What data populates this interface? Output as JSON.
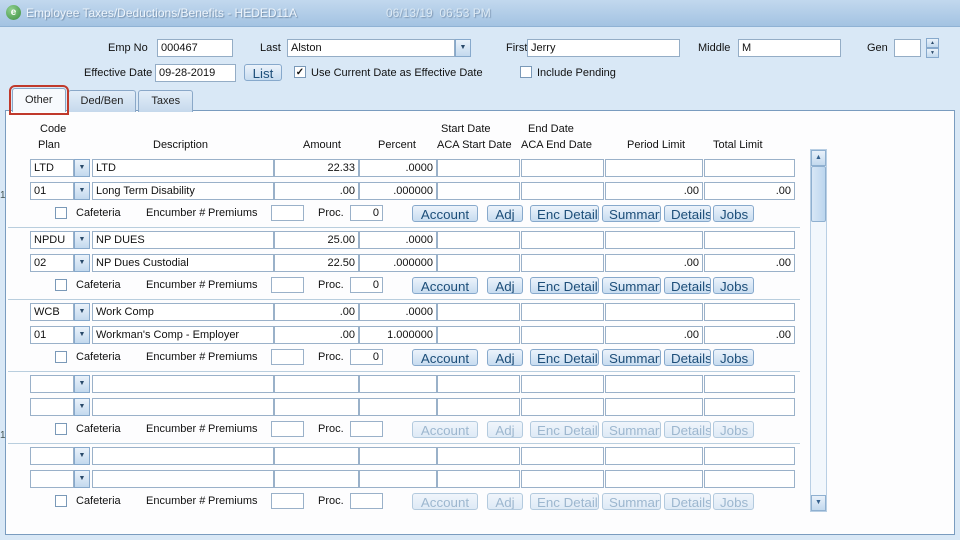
{
  "window": {
    "title": "Employee Taxes/Deductions/Benefits - HEDED11A",
    "timestamp": "06/13/19  06:53 PM"
  },
  "annotation": {
    "highlight_color": "#c0392b",
    "target": "Other tab"
  },
  "icons": {
    "dropdown": "▼",
    "up": "▲",
    "down": "▼",
    "check": "✓",
    "app_logo": "e"
  },
  "header": {
    "emp_no_label": "Emp No",
    "emp_no_value": "000467",
    "last_label": "Last",
    "last_value": "Alston",
    "first_label": "First",
    "first_value": "Jerry",
    "middle_label": "Middle",
    "middle_value": "M",
    "gen_label": "Gen",
    "gen_value": "",
    "effective_date_label": "Effective Date",
    "effective_date_value": "09-28-2019",
    "list_button": "List",
    "use_current_date_label": "Use Current Date as Effective Date",
    "use_current_date_checked": true,
    "include_pending_label": "Include Pending",
    "include_pending_checked": false
  },
  "tabs": [
    {
      "label": "Other",
      "selected": true,
      "highlighted": true
    },
    {
      "label": "Ded/Ben",
      "selected": false,
      "highlighted": false
    },
    {
      "label": "Taxes",
      "selected": false,
      "highlighted": false
    }
  ],
  "grid": {
    "headers": {
      "code": "Code",
      "plan": "Plan",
      "description": "Description",
      "amount": "Amount",
      "percent": "Percent",
      "start_date": "Start Date",
      "aca_start_date": "ACA Start Date",
      "end_date": "End Date",
      "aca_end_date": "ACA End Date",
      "period_limit": "Period Limit",
      "total_limit": "Total Limit"
    },
    "control_labels": {
      "cafeteria": "Cafeteria",
      "encumber": "Encumber #",
      "premiums": "Premiums",
      "proc": "Proc.",
      "buttons": [
        "Account",
        "Adj",
        "Enc Details",
        "Summary",
        "Details",
        "Jobs"
      ]
    },
    "groups": [
      {
        "code": "LTD",
        "code_desc": "LTD",
        "code_amount": "22.33",
        "code_percent": ".0000",
        "code_aca_start": "",
        "code_aca_end": "",
        "code_period_limit": "",
        "code_total_limit": "",
        "plan": "01",
        "plan_desc": "Long Term Disability",
        "plan_amount": ".00",
        "plan_percent": ".000000",
        "plan_aca_start": "",
        "plan_aca_end": "",
        "plan_period_limit": ".00",
        "plan_total_limit": ".00",
        "cafeteria_checked": false,
        "premiums_value": "",
        "proc_value": "0",
        "enabled": true
      },
      {
        "code": "NPDU",
        "code_desc": "NP DUES",
        "code_amount": "25.00",
        "code_percent": ".0000",
        "code_aca_start": "",
        "code_aca_end": "",
        "code_period_limit": "",
        "code_total_limit": "",
        "plan": "02",
        "plan_desc": "NP Dues Custodial",
        "plan_amount": "22.50",
        "plan_percent": ".000000",
        "plan_aca_start": "",
        "plan_aca_end": "",
        "plan_period_limit": ".00",
        "plan_total_limit": ".00",
        "cafeteria_checked": false,
        "premiums_value": "",
        "proc_value": "0",
        "enabled": true
      },
      {
        "code": "WCB",
        "code_desc": "Work Comp",
        "code_amount": ".00",
        "code_percent": ".0000",
        "code_aca_start": "",
        "code_aca_end": "",
        "code_period_limit": "",
        "code_total_limit": "",
        "plan": "01",
        "plan_desc": "Workman's Comp - Employer",
        "plan_amount": ".00",
        "plan_percent": "1.000000",
        "plan_aca_start": "",
        "plan_aca_end": "",
        "plan_period_limit": ".00",
        "plan_total_limit": ".00",
        "cafeteria_checked": false,
        "premiums_value": "",
        "proc_value": "0",
        "enabled": true
      },
      {
        "code": "",
        "code_desc": "",
        "code_amount": "",
        "code_percent": "",
        "code_aca_start": "",
        "code_aca_end": "",
        "code_period_limit": "",
        "code_total_limit": "",
        "plan": "",
        "plan_desc": "",
        "plan_amount": "",
        "plan_percent": "",
        "plan_aca_start": "",
        "plan_aca_end": "",
        "plan_period_limit": "",
        "plan_total_limit": "",
        "cafeteria_checked": false,
        "premiums_value": "",
        "proc_value": "",
        "enabled": false
      },
      {
        "code": "",
        "code_desc": "",
        "code_amount": "",
        "code_percent": "",
        "code_aca_start": "",
        "code_aca_end": "",
        "code_period_limit": "",
        "code_total_limit": "",
        "plan": "",
        "plan_desc": "",
        "plan_amount": "",
        "plan_percent": "",
        "plan_aca_start": "",
        "plan_aca_end": "",
        "plan_period_limit": "",
        "plan_total_limit": "",
        "cafeteria_checked": false,
        "premiums_value": "",
        "proc_value": "",
        "enabled": false
      }
    ]
  },
  "left_edge_markers": [
    "1",
    "1"
  ]
}
